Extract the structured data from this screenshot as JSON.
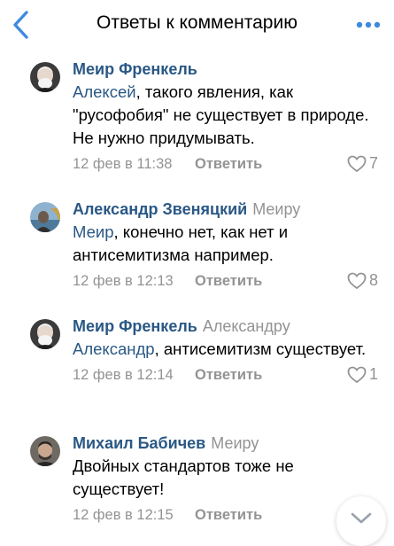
{
  "header": {
    "title": "Ответы к комментарию"
  },
  "comments": [
    {
      "author": "Меир Френкель",
      "reply_to": "",
      "mention": "Алексей",
      "text": ", такого явления, как \"русофобия\" не существует в природе. Не нужно придумывать.",
      "date": "12 фев в 11:38",
      "reply_label": "Ответить",
      "likes": "7"
    },
    {
      "author": "Александр Звеняцкий",
      "reply_to": "Меиру",
      "mention": "Меир",
      "text": ", конечно нет, как нет и антисемитизма например.",
      "date": "12 фев в 12:13",
      "reply_label": "Ответить",
      "likes": "8"
    },
    {
      "author": "Меир Френкель",
      "reply_to": "Александру",
      "mention": "Александр",
      "text": ", антисемитизм существует.",
      "date": "12 фев в 12:14",
      "reply_label": "Ответить",
      "likes": "1"
    },
    {
      "author": "Михаил Бабичев",
      "reply_to": "Меиру",
      "mention": "",
      "text": "Двойных стандартов тоже не существует!",
      "date": "12 фев в 12:15",
      "reply_label": "Ответить",
      "likes": ""
    }
  ],
  "colors": {
    "accent": "#2a5885",
    "meta": "#939393",
    "back": "#3f8ae0"
  },
  "icons": {
    "back": "chevron-left-icon",
    "more": "more-dots-icon",
    "like": "heart-icon",
    "scroll": "chevron-down-icon"
  }
}
